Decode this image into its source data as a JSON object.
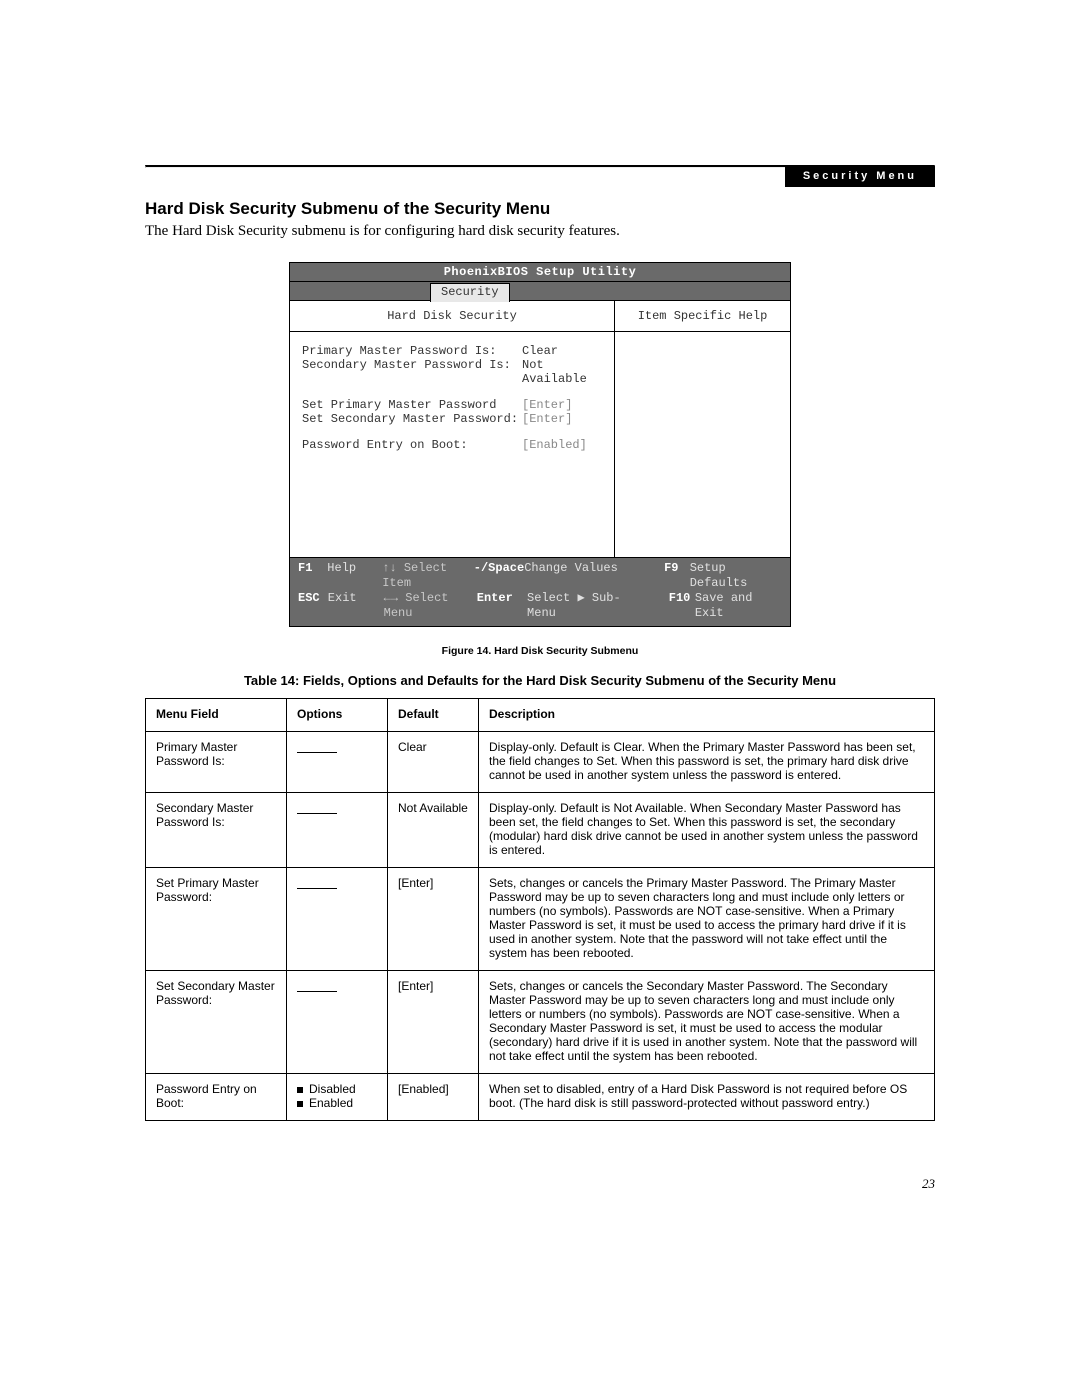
{
  "header_tag": "Security Menu",
  "heading": "Hard Disk Security Submenu of the Security Menu",
  "intro": "The Hard Disk Security submenu is for configuring hard disk security features.",
  "bios": {
    "title": "PhoenixBIOS Setup Utility",
    "active_tab": "Security",
    "left_header": "Hard Disk Security",
    "right_header": "Item Specific Help",
    "rows": [
      {
        "label": "Primary Master Password Is:",
        "value": "Clear",
        "dim": false
      },
      {
        "label": "Secondary Master Password Is:",
        "value": "Not Available",
        "dim": false
      }
    ],
    "rows2": [
      {
        "label": "Set Primary Master Password",
        "value": "[Enter]",
        "dim": true
      },
      {
        "label": "Set Secondary Master Password:",
        "value": "[Enter]",
        "dim": true
      }
    ],
    "rows3": [
      {
        "label": "Password Entry on Boot:",
        "value": "[Enabled]",
        "dim": true
      }
    ],
    "footer": {
      "r1": {
        "k1": "F1",
        "l1": "Help",
        "a1": "↑↓ Select Item",
        "k2": "-/Space",
        "d2": "Change Values",
        "k3": "F9",
        "l3": "Setup Defaults"
      },
      "r2": {
        "k1": "ESC",
        "l1": "Exit",
        "a1": "←→ Select Menu",
        "k2": "Enter",
        "d2": "Select ▶ Sub-Menu",
        "k3": "F10",
        "l3": "Save and Exit"
      }
    }
  },
  "figure_caption": "Figure 14.   Hard Disk Security Submenu",
  "table_caption": "Table 14: Fields, Options and Defaults for the Hard Disk Security Submenu of the Security Menu",
  "table": {
    "headers": {
      "mf": "Menu Field",
      "op": "Options",
      "df": "Default",
      "de": "Description"
    },
    "rows": [
      {
        "mf": "Primary Master Password Is:",
        "op_type": "dash",
        "op": "",
        "df": "Clear",
        "de": "Display-only. Default is Clear. When the Primary Master Password has been set, the field changes to Set. When this password is set, the primary hard disk drive cannot be used in another system unless the password is entered."
      },
      {
        "mf": "Secondary Master Password Is:",
        "op_type": "dash",
        "op": "",
        "df": "Not Available",
        "de": "Display-only. Default is Not Available. When Secondary Master Password has been set, the field changes to Set. When this password is set, the secondary (modular) hard disk drive cannot be used in another system unless the password is entered."
      },
      {
        "mf": "Set Primary Master Password:",
        "op_type": "dash",
        "op": "",
        "df": "[Enter]",
        "de": "Sets, changes or cancels the Primary Master Password. The Primary Master Password may be up to seven characters long and must include only letters or numbers (no symbols). Passwords are NOT case-sensitive. When a Primary Master Password is set, it must be used to access the primary hard drive if it is used in another system. Note that the password will not take effect until the system has been rebooted."
      },
      {
        "mf": "Set Secondary Master Password:",
        "op_type": "dash",
        "op": "",
        "df": "[Enter]",
        "de": "Sets, changes or cancels the Secondary Master Password. The Secondary Master Password may be up to seven characters long and must include only letters or numbers (no symbols). Passwords are NOT case-sensitive. When a Secondary Master Password is set, it must be used to access the modular (secondary) hard drive if it is used in another system. Note that the password will not take effect until the system has been rebooted."
      },
      {
        "mf": "Password Entry on Boot:",
        "op_type": "list",
        "op_items": [
          "Disabled",
          "Enabled"
        ],
        "df": "[Enabled]",
        "de": "When set to disabled, entry of a Hard Disk Password is not required before OS boot. (The hard disk is still password-protected without password entry.)"
      }
    ]
  },
  "page_number": "23"
}
